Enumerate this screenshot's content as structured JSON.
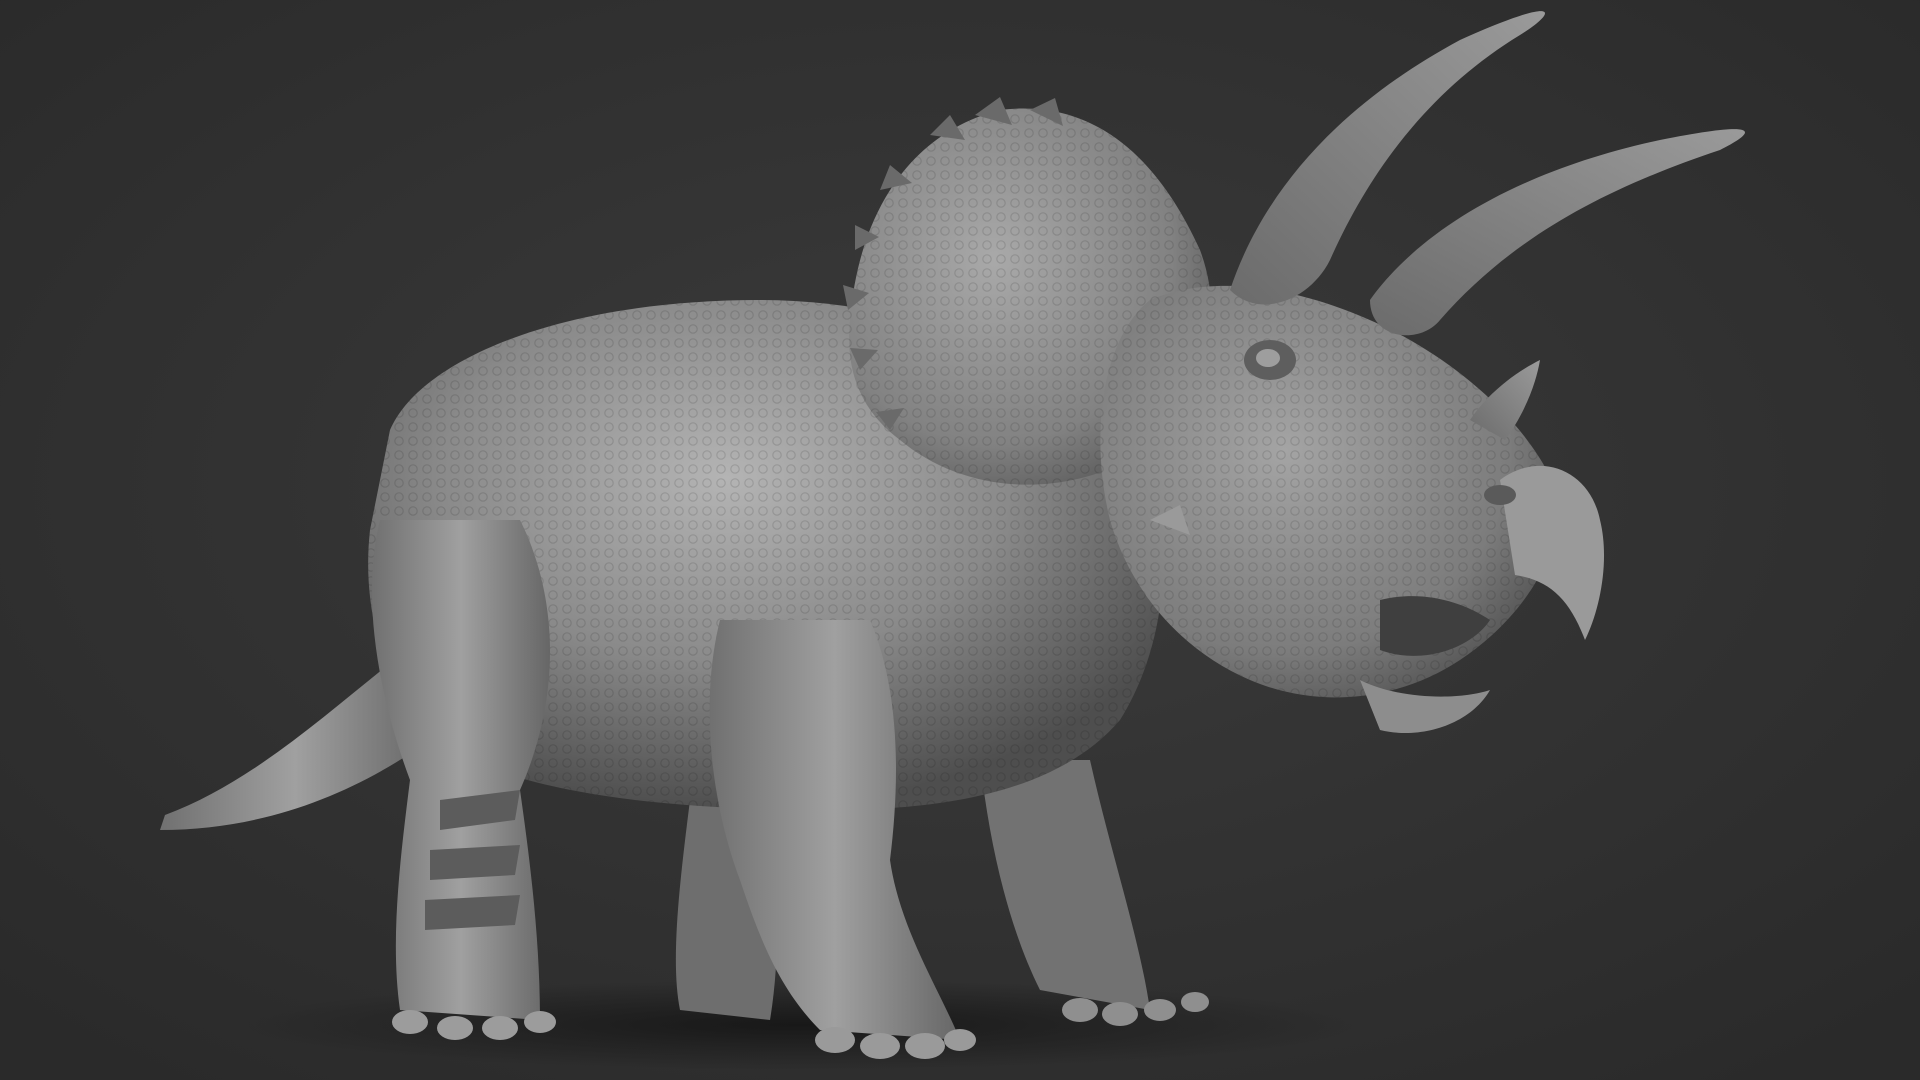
{
  "scene": {
    "subject": "triceratops-sculpt",
    "render_style": "grey clay sculpt render",
    "colors": {
      "background": "#303030",
      "background_center": "#3a3a3a",
      "clay_light": "#b9b9b9",
      "clay_mid": "#8e8e8e",
      "clay_dark": "#5a5a5a",
      "clay_shadow": "#3c3c3c",
      "floor_shadow": "#1c1c1c"
    }
  }
}
